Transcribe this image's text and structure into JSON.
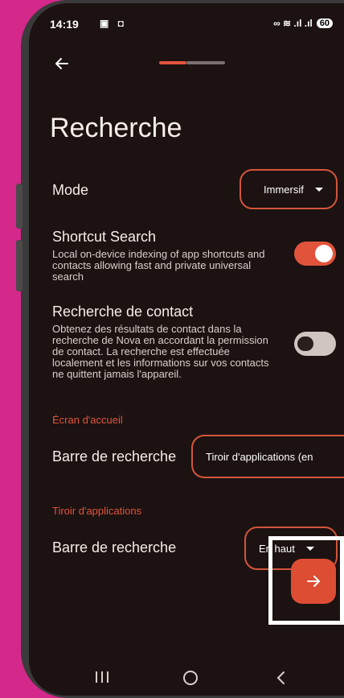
{
  "status_bar": {
    "time": "14:19",
    "notification_icons": "▣ ◘",
    "right_icons": "∞ ≋ .ıl .ıl",
    "battery": "60"
  },
  "header": {
    "title": "Recherche"
  },
  "mode": {
    "label": "Mode",
    "value": "Immersif"
  },
  "shortcut_search": {
    "label": "Shortcut Search",
    "description": "Local on-device indexing of app shortcuts and contacts allowing fast and private universal search",
    "enabled": true
  },
  "contact_search": {
    "label": "Recherche de contact",
    "description": "Obtenez des résultats de contact dans la recherche de Nova en accordant la permission de contact. La recherche est effectuée localement et les informations sur vos contacts ne quittent jamais l'appareil.",
    "enabled": false
  },
  "home_screen": {
    "section_title": "Écran d'accueil",
    "search_bar_label": "Barre de recherche",
    "search_bar_value": "Tiroir d'applications (en"
  },
  "app_drawer": {
    "section_title": "Tiroir d'applications",
    "search_bar_label": "Barre de recherche",
    "search_bar_value": "En haut"
  },
  "icons": {
    "back": "arrow-left-icon",
    "fab": "arrow-right-icon",
    "nav_recent": "recent-apps-icon",
    "nav_home": "home-icon",
    "nav_back": "back-chevron-icon"
  },
  "colors": {
    "accent": "#e2533b",
    "background": "#1c1211",
    "device_background": "#d4288a"
  }
}
